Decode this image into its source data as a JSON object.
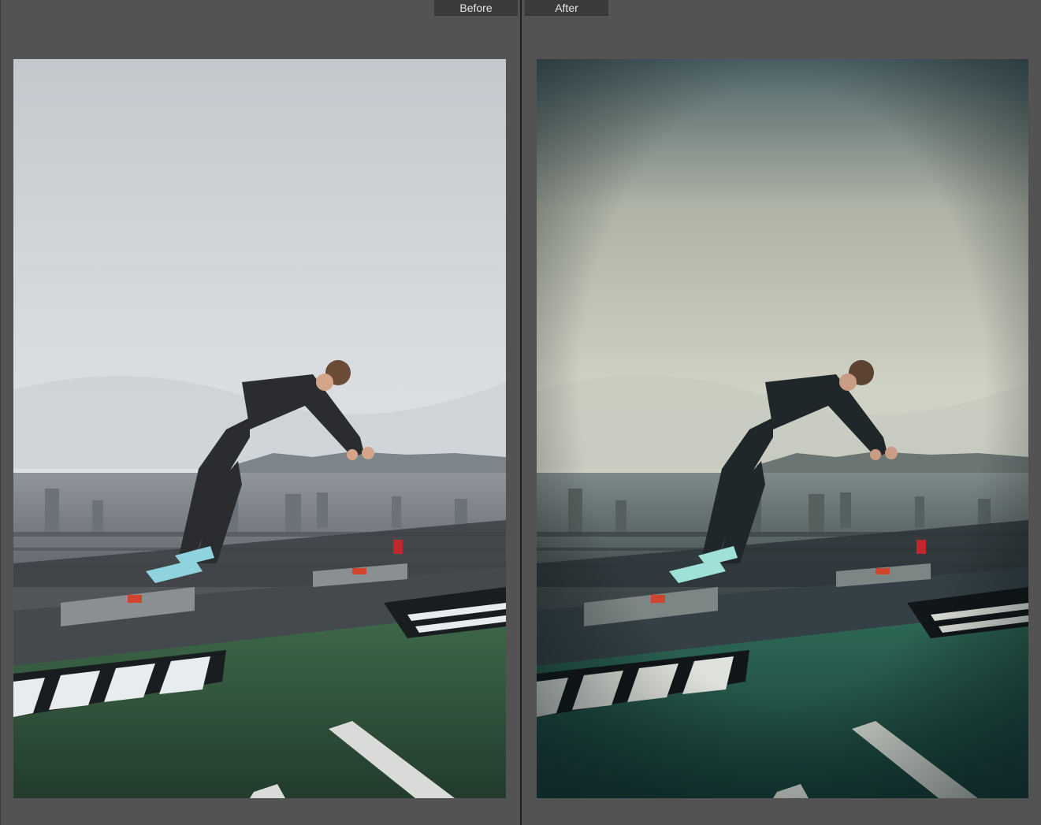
{
  "tabs": {
    "before_label": "Before",
    "after_label": "After"
  },
  "colors": {
    "background": "#535353",
    "tab_background": "#3b3b3b",
    "tab_text": "#e6e6e6",
    "divider": "#1e1e1e"
  },
  "photos": {
    "before": "before-photo",
    "after": "after-photo"
  }
}
